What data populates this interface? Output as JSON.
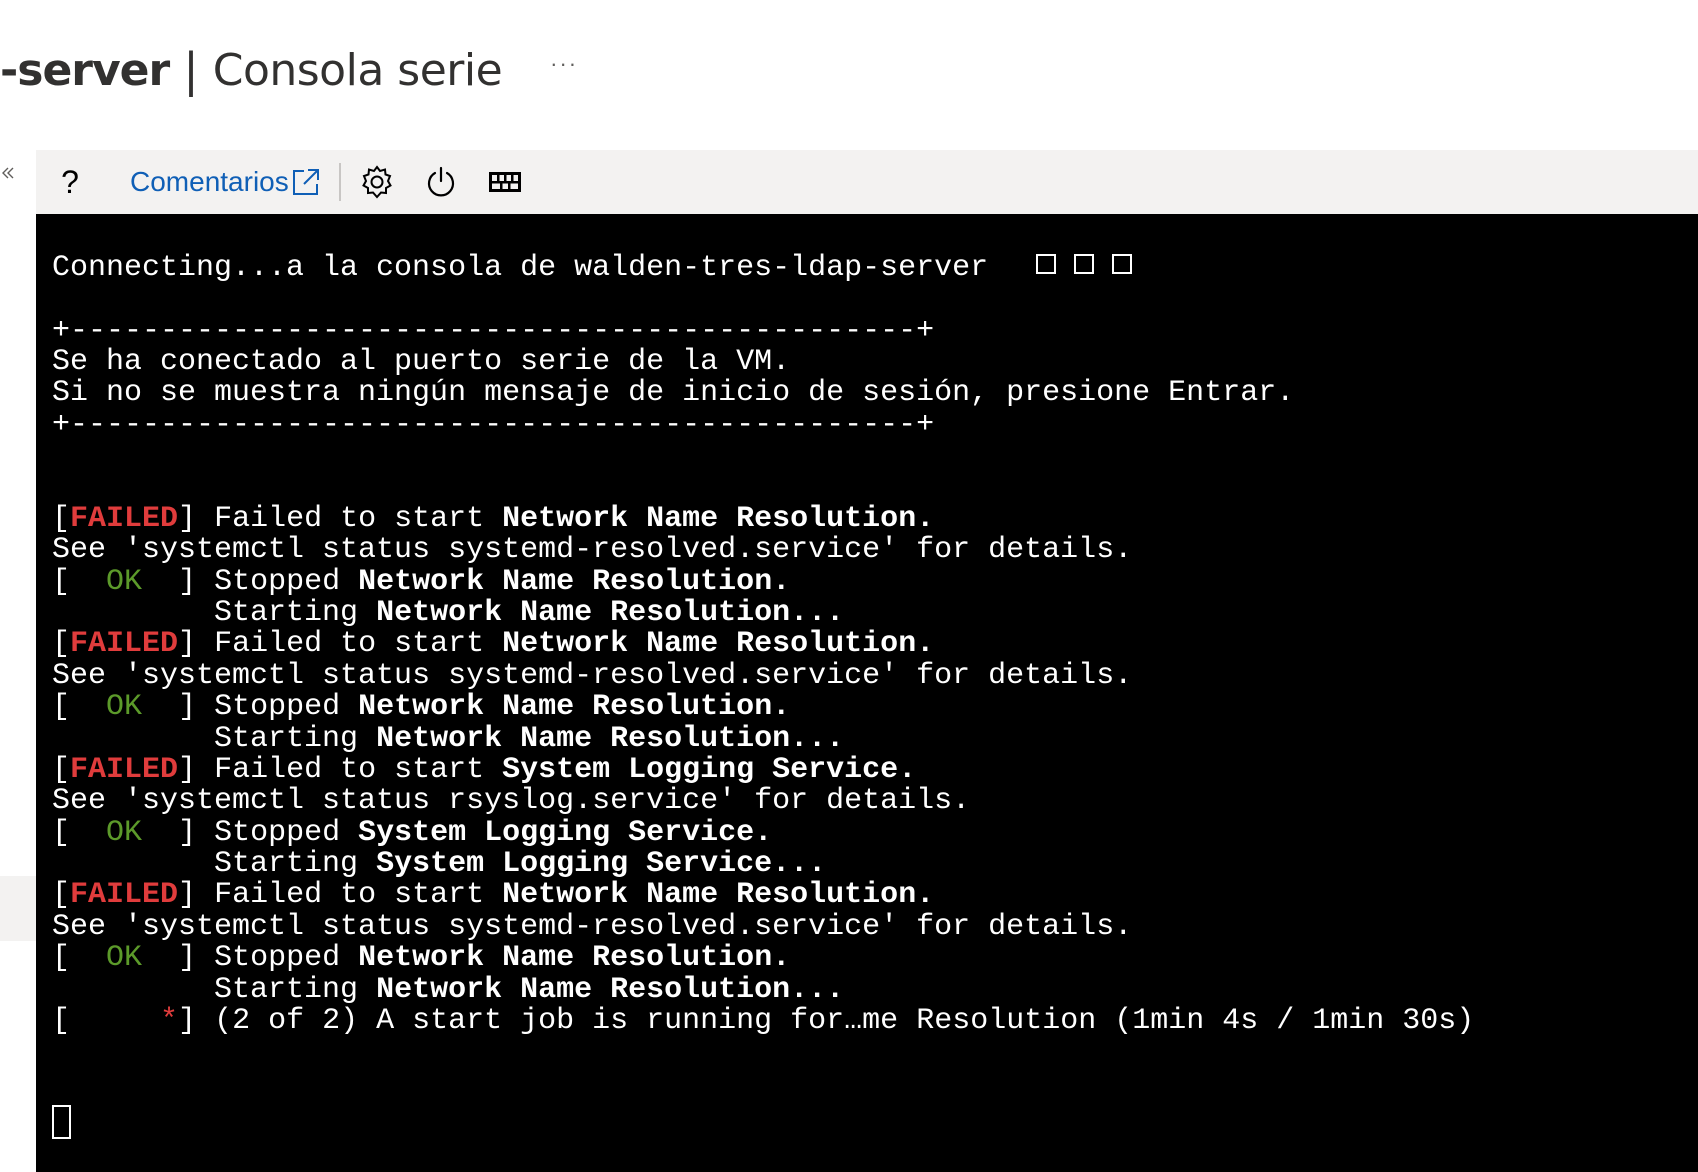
{
  "header": {
    "resource_name": "-server",
    "separator": "|",
    "section_title": "Consola serie",
    "more_label": "···"
  },
  "toolbar": {
    "help_label": "?",
    "feedback_label": "Comentarios",
    "icons": [
      "help-icon",
      "external-link-icon",
      "gear-icon",
      "power-icon",
      "keyboard-icon"
    ]
  },
  "terminal": {
    "connect_line": "Connecting...a la consola de walden-tres-ldap-server",
    "border": "+-----------------------------------------------+",
    "msg1": "Se ha conectado al puerto serie de la VM.",
    "msg2": "Si no se muestra ningún mensaje de inicio de sesión, presione Entrar.",
    "lbr": "[",
    "rbr": "]",
    "failed_tag": "FAILED",
    "ok_tag": "OK",
    "failed_text": "Failed to start ",
    "stopped_text": "Stopped ",
    "starting_text": "Starting ",
    "see_prefix": "See ",
    "for_details": " for details.",
    "svc_resolved_name": "Network Name Resolution",
    "svc_resolved_cmd": "'systemctl status systemd-resolved.service'",
    "svc_logging_name": "System Logging Service",
    "svc_logging_cmd": "'systemctl status rsyslog.service'",
    "dot": ".",
    "ellipsis": "...",
    "star": "*",
    "job_line": "(2 of 2) A start job is running for…me Resolution (1min 4s / 1min 30s)"
  },
  "colors": {
    "failed": "#e03c3c",
    "ok": "#5c9a2a",
    "link": "#0f5fb6",
    "terminal_bg": "#000000"
  }
}
